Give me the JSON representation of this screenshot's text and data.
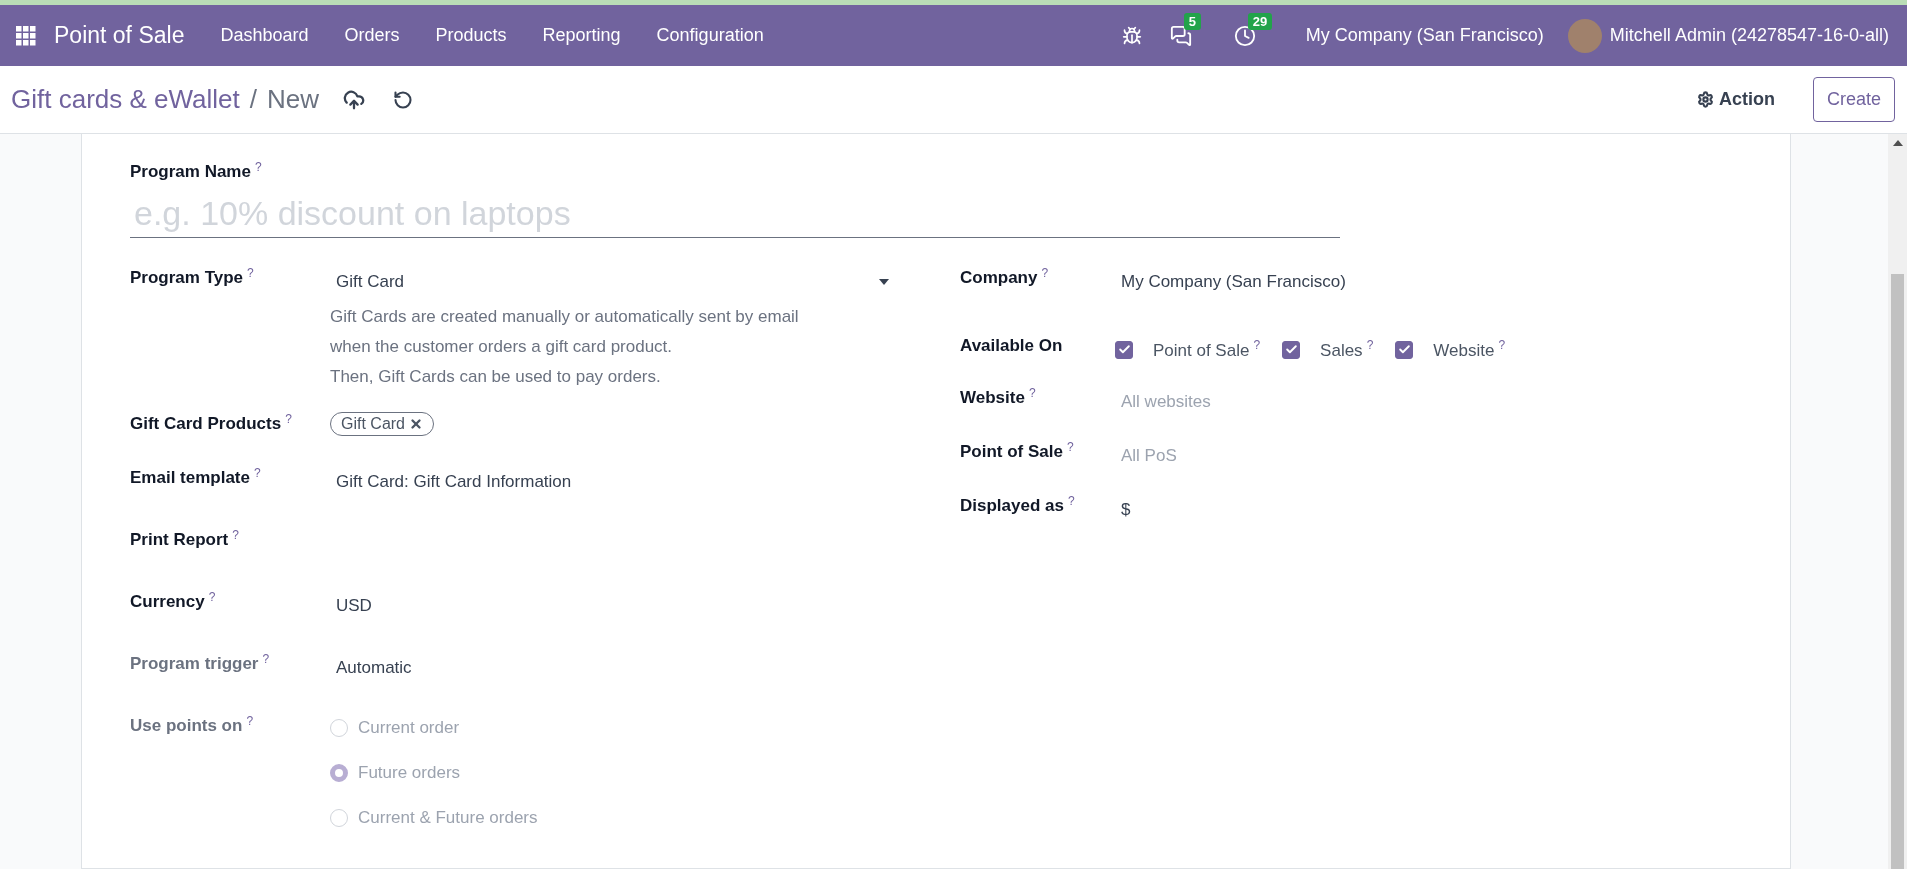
{
  "navbar": {
    "app_name": "Point of Sale",
    "menu": [
      "Dashboard",
      "Orders",
      "Products",
      "Reporting",
      "Configuration"
    ],
    "messages_count": "5",
    "activities_count": "29",
    "company": "My Company (San Francisco)",
    "user": "Mitchell Admin (24278547-16-0-all)"
  },
  "control_panel": {
    "breadcrumb_parent": "Gift cards & eWallet",
    "breadcrumb_separator": "/",
    "breadcrumb_current": "New",
    "action_label": "Action",
    "create_label": "Create"
  },
  "form": {
    "program_name": {
      "label": "Program Name",
      "help": "?",
      "placeholder": "e.g. 10% discount on laptops"
    },
    "left_fields": [
      {
        "kind": "select",
        "label": "Program Type",
        "help": "?",
        "readonly": false,
        "value": "Gift Card",
        "description_lines": [
          "Gift Cards are created manually or automatically sent by email",
          "when the customer orders a gift card product.",
          "Then, Gift Cards can be used to pay orders."
        ]
      },
      {
        "kind": "tags",
        "label": "Gift Card Products",
        "help": "?",
        "readonly": false,
        "tags": [
          "Gift Card"
        ]
      },
      {
        "kind": "text",
        "label": "Email template",
        "help": "?",
        "readonly": false,
        "value": "Gift Card: Gift Card Information"
      },
      {
        "kind": "empty",
        "label": "Print Report",
        "help": "?",
        "readonly": false
      },
      {
        "kind": "text",
        "label": "Currency",
        "help": "?",
        "readonly": false,
        "value": "USD"
      },
      {
        "kind": "text",
        "label": "Program trigger",
        "help": "?",
        "readonly": true,
        "value": "Automatic"
      },
      {
        "kind": "radio",
        "label": "Use points on",
        "help": "?",
        "readonly": true,
        "options": [
          {
            "label": "Current order",
            "selected": false
          },
          {
            "label": "Future orders",
            "selected": true
          },
          {
            "label": "Current & Future orders",
            "selected": false
          }
        ]
      }
    ],
    "right_fields": [
      {
        "kind": "text",
        "label": "Company",
        "help": "?",
        "value": "My Company (San Francisco)"
      },
      {
        "kind": "checkboxes",
        "label": "Available On",
        "options": [
          {
            "label": "Point of Sale",
            "help": "?",
            "checked": true
          },
          {
            "label": "Sales",
            "help": "?",
            "checked": true
          },
          {
            "label": "Website",
            "help": "?",
            "checked": true
          }
        ]
      },
      {
        "kind": "placeholder",
        "label": "Website",
        "help": "?",
        "placeholder": "All websites"
      },
      {
        "kind": "placeholder",
        "label": "Point of Sale",
        "help": "?",
        "placeholder": "All PoS"
      },
      {
        "kind": "text",
        "label": "Displayed as",
        "help": "?",
        "value": "$"
      }
    ]
  }
}
